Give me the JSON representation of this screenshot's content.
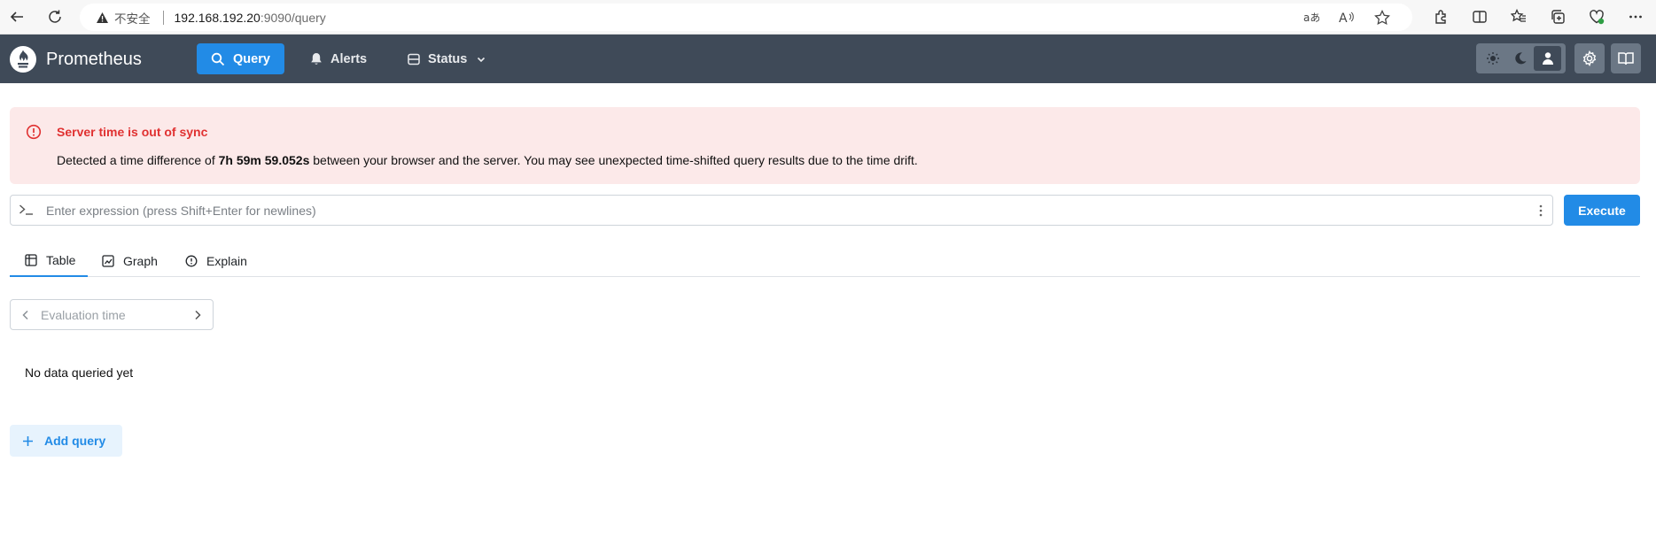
{
  "browser": {
    "insecure_label": "不安全",
    "url_host": "192.168.192.20",
    "url_path": ":9090/query",
    "address_icons": [
      "read-aloud-icon",
      "text-size-icon",
      "favorite-star-icon"
    ],
    "toolbar_icons": [
      "extensions-icon",
      "split-screen-icon",
      "favorites-icon",
      "collections-icon",
      "browser-essentials-icon",
      "more-icon"
    ]
  },
  "navbar": {
    "brand": "Prometheus",
    "query_label": "Query",
    "alerts_label": "Alerts",
    "status_label": "Status"
  },
  "alert": {
    "title": "Server time is out of sync",
    "message_prefix": "Detected a time difference of ",
    "time_difference": "7h 59m 59.052s",
    "message_suffix": " between your browser and the server. You may see unexpected time-shifted query results due to the time drift."
  },
  "query": {
    "placeholder": "Enter expression (press Shift+Enter for newlines)",
    "value": "",
    "execute_label": "Execute"
  },
  "tabs": {
    "table": "Table",
    "graph": "Graph",
    "explain": "Explain",
    "active": "Table"
  },
  "eval_time": {
    "placeholder": "Evaluation time"
  },
  "results": {
    "empty_message": "No data queried yet"
  },
  "add_query_label": "Add query",
  "colors": {
    "navbar_bg": "#3f4a58",
    "accent": "#228be6",
    "error": "#e03131",
    "alert_bg": "#fce9e9"
  }
}
